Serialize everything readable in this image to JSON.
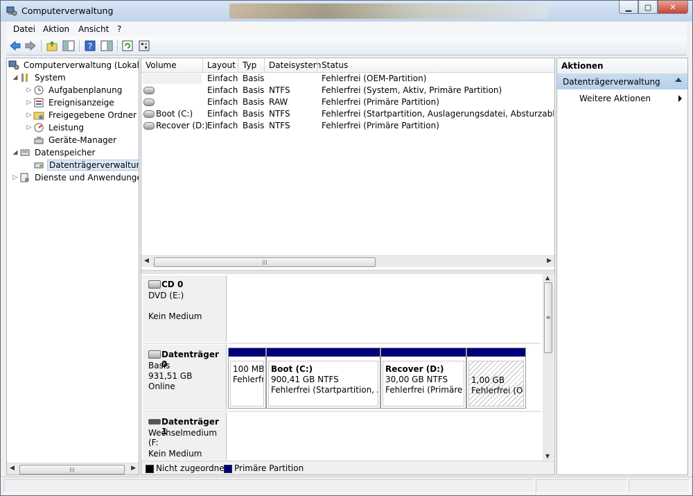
{
  "window": {
    "title": "Computerverwaltung"
  },
  "menu": [
    "Datei",
    "Aktion",
    "Ansicht",
    "?"
  ],
  "toolbar": {
    "icons": [
      "back-icon",
      "forward-icon",
      "up-folder-icon",
      "show-tree-icon",
      "help-icon",
      "show-action-pane-icon",
      "refresh-icon",
      "properties-icon"
    ]
  },
  "tree": {
    "root": "Computerverwaltung (Lokal)",
    "system": "System",
    "items_system": [
      "Aufgabenplanung",
      "Ereignisanzeige",
      "Freigegebene Ordner",
      "Leistung",
      "Geräte-Manager"
    ],
    "storage": "Datenspeicher",
    "disk_mgmt": "Datenträgerverwaltung",
    "services": "Dienste und Anwendungen"
  },
  "volumes": {
    "columns": [
      "Volume",
      "Layout",
      "Typ",
      "Dateisystem",
      "Status"
    ],
    "rows": [
      {
        "volume": "",
        "layout": "Einfach",
        "type": "Basis",
        "fs": "",
        "status": "Fehlerfrei (OEM-Partition)"
      },
      {
        "volume": "",
        "layout": "Einfach",
        "type": "Basis",
        "fs": "NTFS",
        "status": "Fehlerfrei (System, Aktiv, Primäre Partition)"
      },
      {
        "volume": "",
        "layout": "Einfach",
        "type": "Basis",
        "fs": "RAW",
        "status": "Fehlerfrei (Primäre Partition)"
      },
      {
        "volume": "Boot (C:)",
        "layout": "Einfach",
        "type": "Basis",
        "fs": "NTFS",
        "status": "Fehlerfrei (Startpartition, Auslagerungsdatei, Absturzabbild, Prim"
      },
      {
        "volume": "Recover (D:)",
        "layout": "Einfach",
        "type": "Basis",
        "fs": "NTFS",
        "status": "Fehlerfrei (Primäre Partition)"
      }
    ]
  },
  "disks": {
    "cd0": {
      "name": "CD 0",
      "line1": "DVD (E:)",
      "line2": "Kein Medium"
    },
    "disk0": {
      "name": "Datenträger 0",
      "line1": "Basis",
      "line2": "931,51 GB",
      "line3": "Online",
      "partitions": [
        {
          "name": "",
          "size": "100 MB",
          "status": "Fehlerfrei"
        },
        {
          "name": "Boot  (C:)",
          "size": "900,41 GB NTFS",
          "status": "Fehlerfrei (Startpartition, Aus"
        },
        {
          "name": "Recover  (D:)",
          "size": "30,00 GB NTFS",
          "status": "Fehlerfrei (Primäre P"
        },
        {
          "name": "",
          "size": "1,00 GB",
          "status": "Fehlerfrei (OE"
        }
      ]
    },
    "disk1": {
      "name": "Datenträger 1",
      "line1": "Wechselmedium (F:",
      "line2": "Kein Medium"
    }
  },
  "legend": {
    "unallocated": "Nicht zugeordnet",
    "unallocated_color": "#000000",
    "primary": "Primäre Partition",
    "primary_color": "#00007a"
  },
  "actions": {
    "header": "Aktionen",
    "section": "Datenträgerverwaltung",
    "item": "Weitere Aktionen"
  }
}
